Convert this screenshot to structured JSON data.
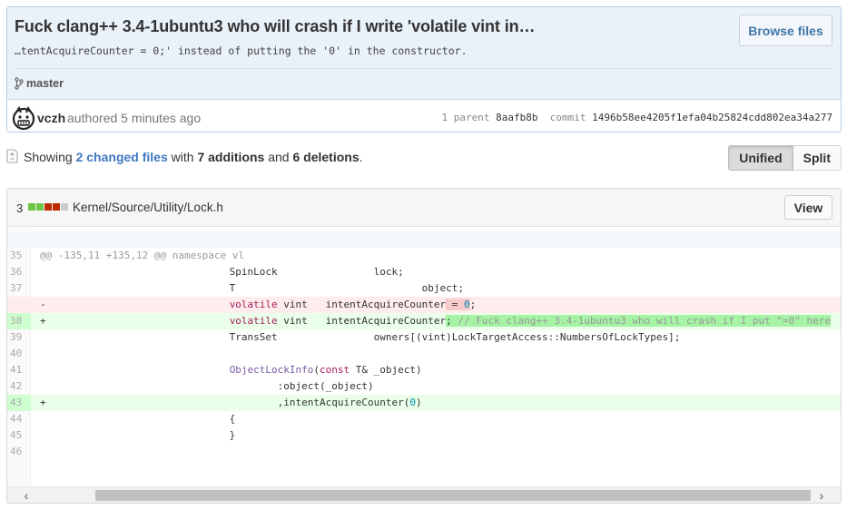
{
  "commit": {
    "title": "Fuck clang++ 3.4-1ubuntu3 who will crash if I write 'volatile vint in…",
    "description": "…tentAcquireCounter = 0;' instead of putting the '0' in the constructor.",
    "browse_label": "Browse files",
    "branch": "master",
    "author": "vczh",
    "authored": "authored 5 minutes ago",
    "parent_label": "1 parent",
    "parent_sha": "8aafb8b",
    "commit_label": "commit",
    "commit_sha": "1496b58ee4205f1efa04b25824cdd802ea34a277"
  },
  "toc": {
    "showing": "Showing",
    "changed_files": "2 changed files",
    "with": "with",
    "additions": "7 additions",
    "and": "and",
    "deletions": "6 deletions",
    "period": ".",
    "unified_label": "Unified",
    "split_label": "Split"
  },
  "file": {
    "count": "3",
    "path": "Kernel/Source/Utility/Lock.h",
    "view_label": "View",
    "diffstat_colors": [
      "#6cc644",
      "#6cc644",
      "#bd2c00",
      "#bd2c00",
      "#cccccc"
    ],
    "hunk_header": "@@ -135,11 +135,12 @@ namespace vl",
    "lines": [
      {
        "num": "35",
        "type": "ctx",
        "marker": "",
        "code": ""
      },
      {
        "num": "36",
        "type": "ctx",
        "marker": "",
        "code": "                              SpinLock                lock;"
      },
      {
        "num": "37",
        "type": "ctx",
        "marker": "",
        "code": "                              T                               object;"
      },
      {
        "num": "",
        "type": "del",
        "marker": "-",
        "pre": "                              ",
        "kw": "volatile",
        "mid": " vint   intentAcquireCounter",
        "hl": " = ",
        "num_tok": "0",
        "tail": ";"
      },
      {
        "num": "38",
        "type": "add",
        "marker": "+",
        "pre": "                              ",
        "kw": "volatile",
        "mid": " vint   intentAcquireCounter",
        "hl": "; ",
        "comment": "// Fuck clang++ 3.4-1ubuntu3 who will crash if I put \"=0\" here"
      },
      {
        "num": "39",
        "type": "ctx",
        "marker": "",
        "code": "                              TransSet                owners[(vint)LockTargetAccess::NumbersOfLockTypes];"
      },
      {
        "num": "40",
        "type": "ctx",
        "marker": "",
        "code": ""
      },
      {
        "num": "41",
        "type": "ctx",
        "marker": "",
        "pre": "                              ",
        "fn": "ObjectLockInfo",
        "open": "(",
        "kw": "const",
        "rest": " T& _object)"
      },
      {
        "num": "42",
        "type": "ctx",
        "marker": "",
        "code": "                                      :object(_object)"
      },
      {
        "num": "43",
        "type": "add",
        "marker": "+",
        "pre": "                                      ,intentAcquireCounter(",
        "num_tok": "0",
        "tail": ")"
      },
      {
        "num": "44",
        "type": "ctx",
        "marker": "",
        "code": "                              {"
      },
      {
        "num": "45",
        "type": "ctx",
        "marker": "",
        "code": "                              }"
      },
      {
        "num": "46",
        "type": "ctx",
        "marker": "",
        "code": ""
      }
    ]
  },
  "scroll": {
    "left_arrow": "‹",
    "right_arrow": "›"
  }
}
